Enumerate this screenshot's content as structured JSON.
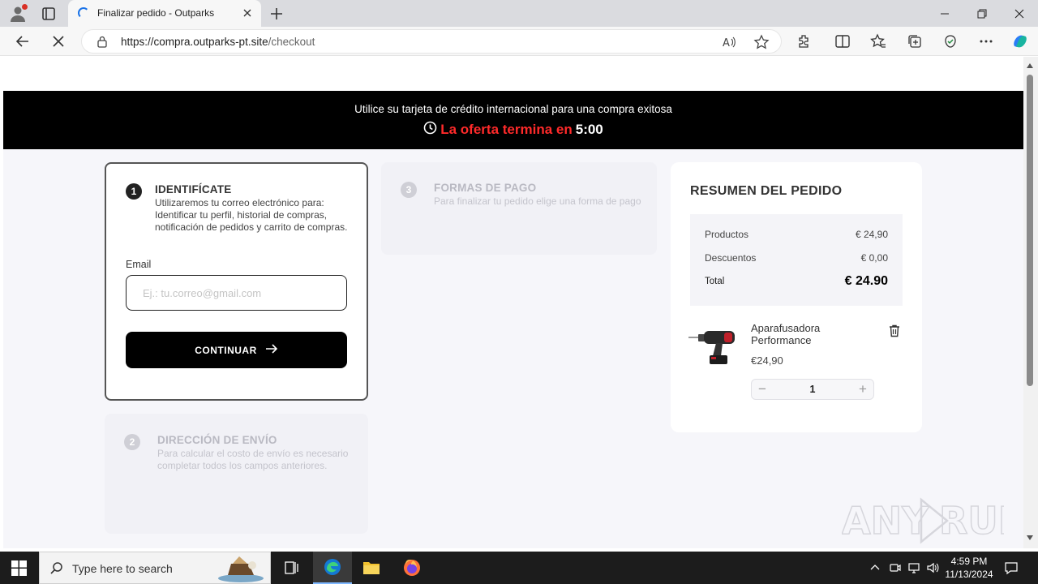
{
  "browser": {
    "tab_title": "Finalizar pedido - Outparks",
    "url_domain": "https://compra.outparks-pt.site",
    "url_path": "/checkout"
  },
  "promo": {
    "line1": "Utilice su tarjeta de crédito internacional para una compra exitosa",
    "offer_label": "La oferta termina en",
    "timer": "5:00"
  },
  "step1": {
    "number": "1",
    "title": "IDENTIFÍCATE",
    "description": "Utilizaremos tu correo electrónico para: Identificar tu perfil, historial de compras, notificación de pedidos y carrito de compras.",
    "email_label": "Email",
    "email_placeholder": "Ej.: tu.correo@gmail.com",
    "continue_label": "CONTINUAR"
  },
  "step2": {
    "number": "2",
    "title": "DIRECCIÓN DE ENVÍO",
    "description": "Para calcular el costo de envío es necesario completar todos los campos anteriores."
  },
  "step3": {
    "number": "3",
    "title": "FORMAS DE PAGO",
    "description": "Para finalizar tu pedido elige una forma de pago"
  },
  "summary": {
    "title": "RESUMEN DEL PEDIDO",
    "products_label": "Productos",
    "products_value": "€ 24,90",
    "discounts_label": "Descuentos",
    "discounts_value": "€ 0,00",
    "total_label": "Total",
    "total_value": "€ 24.90",
    "item": {
      "name": "Aparafusadora Performance",
      "price": "€24,90",
      "quantity": "1"
    }
  },
  "watermark": "ANY RUN",
  "taskbar": {
    "search_placeholder": "Type here to search",
    "time": "4:59 PM",
    "date": "11/13/2024"
  },
  "colors": {
    "accent_red": "#ff2a2a",
    "promo_bg": "#000000",
    "button_bg": "#000000",
    "page_bg": "#f6f6fa"
  }
}
